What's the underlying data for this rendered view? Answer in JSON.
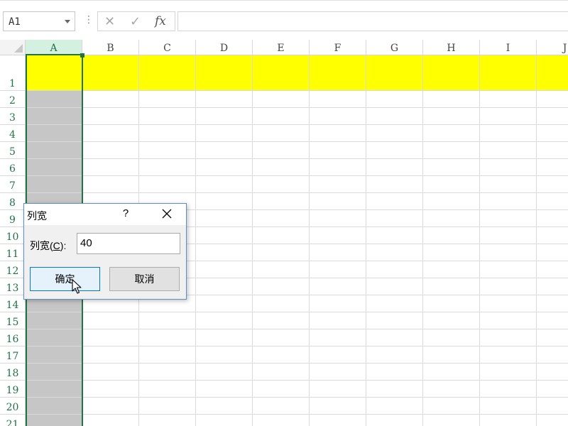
{
  "formula_bar": {
    "name_box_value": "A1",
    "separator": "⋮",
    "cancel_glyph": "✕",
    "enter_glyph": "✓",
    "fx_label": "fx",
    "formula_value": ""
  },
  "sheet": {
    "columns": [
      "A",
      "B",
      "C",
      "D",
      "E",
      "F",
      "G",
      "H",
      "I",
      "J"
    ],
    "selected_column": "A",
    "rows": [
      "1",
      "2",
      "3",
      "4",
      "5",
      "6",
      "7",
      "8",
      "9",
      "10",
      "11",
      "12",
      "13",
      "14",
      "15",
      "16",
      "17",
      "18",
      "19",
      "20",
      "21"
    ],
    "row1_fill_color": "#ffff00",
    "selection_color": "#c6c6c6",
    "accent_color": "#217346"
  },
  "dialog": {
    "title": "列宽",
    "help_glyph": "?",
    "field_label_prefix": "列宽(",
    "field_label_hotkey": "C",
    "field_label_suffix": "):",
    "field_value": "40",
    "ok_label": "确定",
    "cancel_label": "取消"
  },
  "icons": {
    "close": "close-icon",
    "cursor": "mouse-pointer-icon"
  }
}
